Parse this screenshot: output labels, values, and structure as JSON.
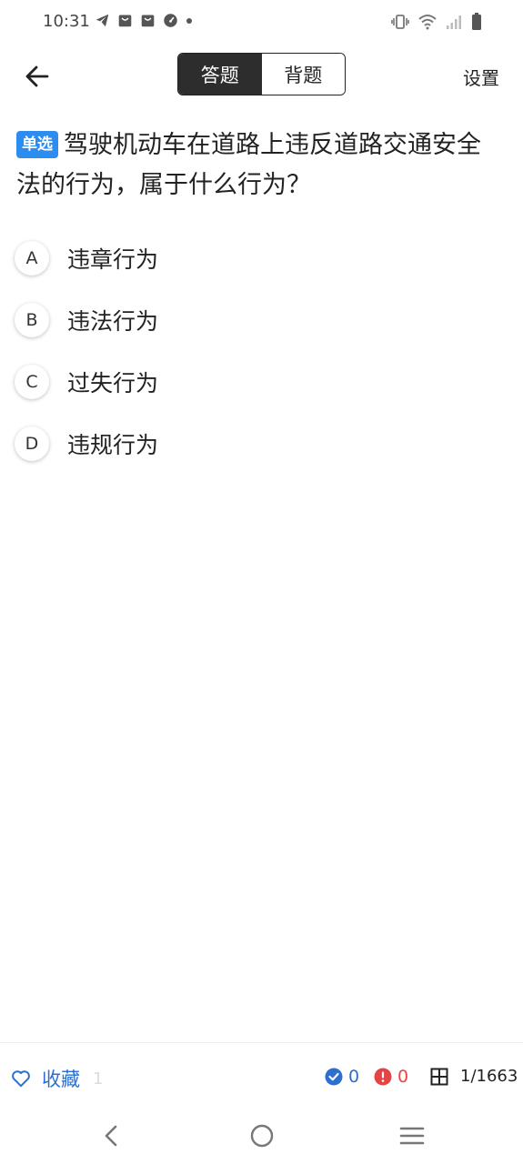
{
  "status_bar": {
    "time": "10:31",
    "left_icons": [
      "telegram-icon",
      "bag-icon",
      "bag-icon",
      "speedometer-icon",
      "dot-icon"
    ],
    "right_icons": [
      "vibrate-icon",
      "wifi-icon",
      "signal-icon",
      "battery-icon"
    ]
  },
  "header": {
    "tabs": [
      {
        "label": "答题",
        "active": true
      },
      {
        "label": "背题",
        "active": false
      }
    ],
    "settings_label": "设置"
  },
  "question": {
    "type_badge": "单选",
    "text": "驾驶机动车在道路上违反道路交通安全法的行为，属于什么行为？",
    "options": [
      {
        "letter": "A",
        "text": "违章行为"
      },
      {
        "letter": "B",
        "text": "违法行为"
      },
      {
        "letter": "C",
        "text": "过失行为"
      },
      {
        "letter": "D",
        "text": "违规行为"
      }
    ]
  },
  "bottom_bar": {
    "favorite_label": "收藏",
    "favorite_count": "1",
    "correct_count": "0",
    "wrong_count": "0",
    "progress": "1/1663"
  },
  "colors": {
    "accent": "#2d6fcf",
    "badge": "#2d8cf0",
    "wrong": "#e44444",
    "tab_active_bg": "#2d2d2d"
  }
}
